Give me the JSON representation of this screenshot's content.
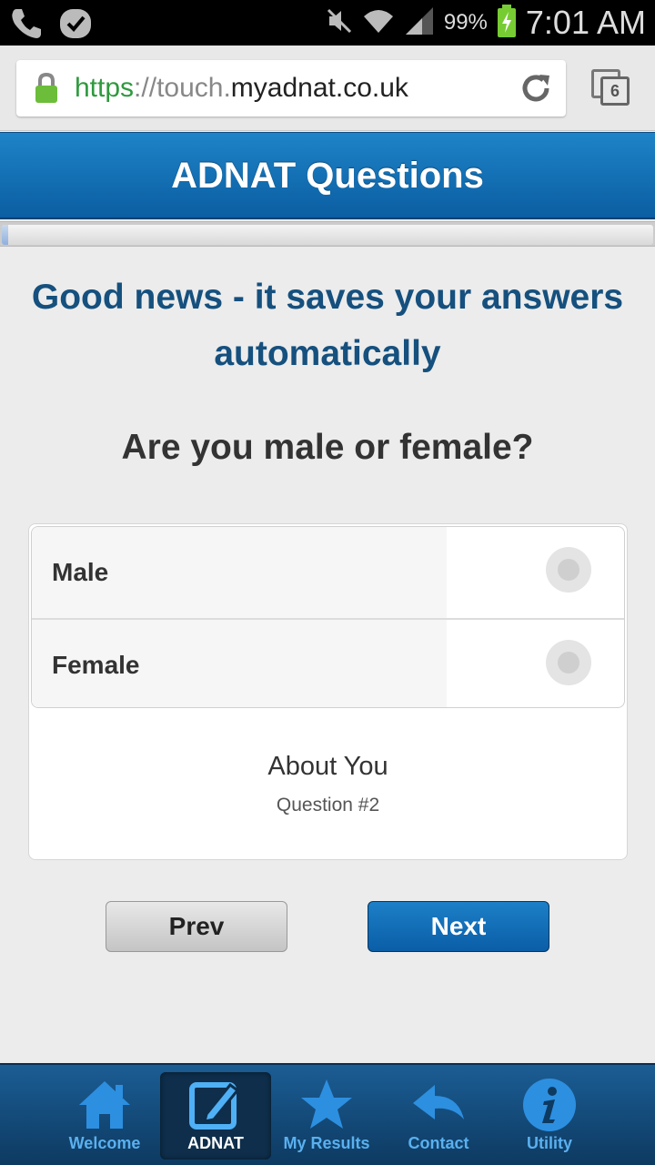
{
  "status_bar": {
    "battery": "99%",
    "time": "7:01 AM"
  },
  "browser": {
    "url_scheme": "https",
    "url_sep": "://",
    "url_subdomain": "touch.",
    "url_domain": "myadnat.co.uk",
    "tab_count": "6"
  },
  "header": {
    "title": "ADNAT Questions"
  },
  "progress": {
    "fraction": 0.01
  },
  "main": {
    "notice_line1": "Good news - it saves your answers",
    "notice_line2": "automatically",
    "question": "Are you male or female?",
    "options": [
      {
        "label": "Male"
      },
      {
        "label": "Female"
      }
    ],
    "section_title": "About You",
    "question_number": "Question #2"
  },
  "buttons": {
    "prev": "Prev",
    "next": "Next"
  },
  "bottom_nav": {
    "items": [
      {
        "label": "Welcome",
        "icon": "home-icon"
      },
      {
        "label": "ADNAT",
        "icon": "edit-icon"
      },
      {
        "label": "My Results",
        "icon": "star-icon"
      },
      {
        "label": "Contact",
        "icon": "reply-icon"
      },
      {
        "label": "Utility",
        "icon": "info-icon"
      }
    ]
  }
}
